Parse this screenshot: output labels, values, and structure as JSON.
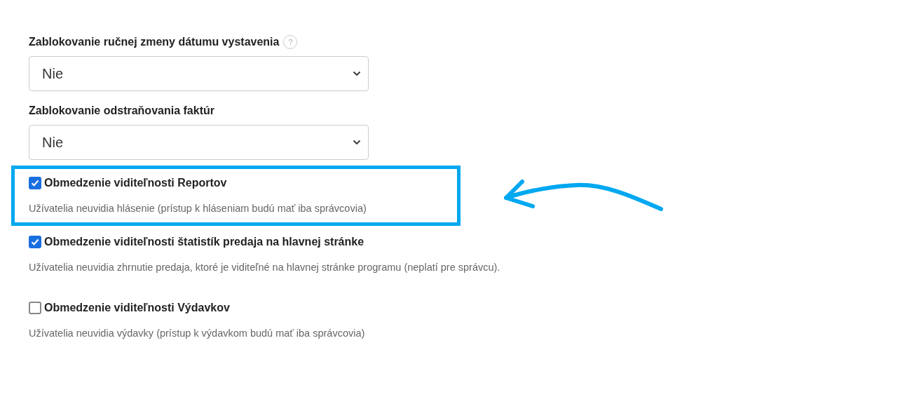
{
  "selects": [
    {
      "label": "Zablokovanie ručnej zmeny dátumu vystavenia",
      "help": "?",
      "value": "Nie"
    },
    {
      "label": "Zablokovanie odstraňovania faktúr",
      "value": "Nie"
    }
  ],
  "options": [
    {
      "label": "Obmedzenie viditeľnosti Reportov",
      "checked": true,
      "highlighted": true,
      "description": "Užívatelia neuvidia hlásenie (prístup k hláseniam budú mať iba správcovia)"
    },
    {
      "label": "Obmedzenie viditeľnosti štatistík predaja na hlavnej stránke",
      "checked": true,
      "highlighted": false,
      "description": "Užívatelia neuvidia zhrnutie predaja, ktoré je viditeľné na hlavnej stránke programu (neplatí pre správcu)."
    },
    {
      "label": "Obmedzenie viditeľnosti Výdavkov",
      "checked": false,
      "highlighted": false,
      "description": "Užívatelia neuvidia výdavky (prístup k výdavkom budú mať iba správcovia)"
    }
  ]
}
